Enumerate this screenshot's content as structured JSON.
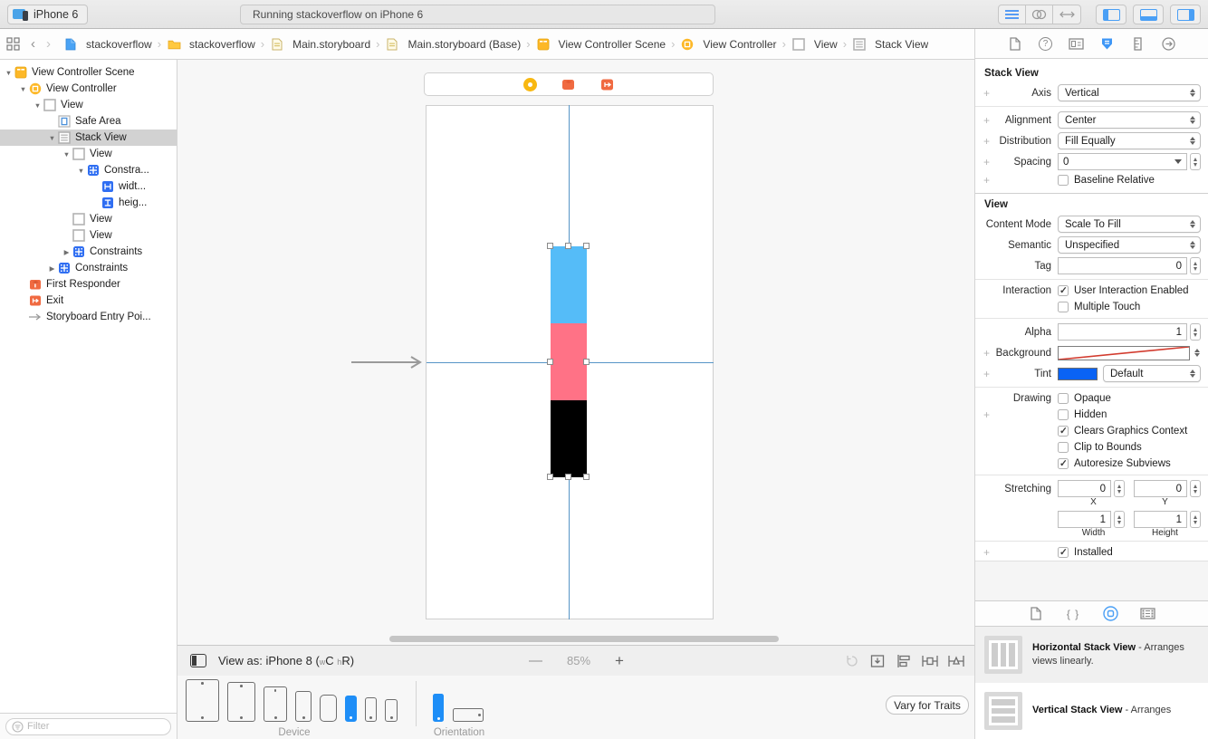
{
  "toolbar": {
    "scheme_label": "iPhone 6",
    "status_text": "Running stackoverflow on iPhone 6"
  },
  "icons": {
    "back_chevron": "‹",
    "forward_chevron": "›",
    "breadcrumb_separator": "›"
  },
  "jumpbar": {
    "items": [
      {
        "label": "stackoverflow",
        "icon": "file-blue"
      },
      {
        "label": "stackoverflow",
        "icon": "folder"
      },
      {
        "label": "Main.storyboard",
        "icon": "storyboard"
      },
      {
        "label": "Main.storyboard (Base)",
        "icon": "storyboard"
      },
      {
        "label": "View Controller Scene",
        "icon": "scene"
      },
      {
        "label": "View Controller",
        "icon": "view-controller"
      },
      {
        "label": "View",
        "icon": "view"
      },
      {
        "label": "Stack View",
        "icon": "stack-view"
      }
    ]
  },
  "outline": {
    "items": [
      {
        "label": "View Controller Scene",
        "indent": 0,
        "disc": "open",
        "icon": "scene",
        "selected": false
      },
      {
        "label": "View Controller",
        "indent": 1,
        "disc": "open",
        "icon": "view-controller",
        "selected": false
      },
      {
        "label": "View",
        "indent": 2,
        "disc": "open",
        "icon": "view",
        "selected": false
      },
      {
        "label": "Safe Area",
        "indent": 3,
        "disc": "none",
        "icon": "safe-area",
        "selected": false
      },
      {
        "label": "Stack View",
        "indent": 3,
        "disc": "open",
        "icon": "stack-view",
        "selected": true
      },
      {
        "label": "View",
        "indent": 4,
        "disc": "open",
        "icon": "view",
        "selected": false
      },
      {
        "label": "Constra...",
        "indent": 5,
        "disc": "open",
        "icon": "constraints",
        "selected": false
      },
      {
        "label": "widt...",
        "indent": 6,
        "disc": "none",
        "icon": "constraint-width",
        "selected": false
      },
      {
        "label": "heig...",
        "indent": 6,
        "disc": "none",
        "icon": "constraint-height",
        "selected": false
      },
      {
        "label": "View",
        "indent": 4,
        "disc": "none",
        "icon": "view",
        "selected": false
      },
      {
        "label": "View",
        "indent": 4,
        "disc": "none",
        "icon": "view",
        "selected": false
      },
      {
        "label": "Constraints",
        "indent": 4,
        "disc": "closed",
        "icon": "constraints",
        "selected": false
      },
      {
        "label": "Constraints",
        "indent": 3,
        "disc": "closed",
        "icon": "constraints",
        "selected": false
      },
      {
        "label": "First Responder",
        "indent": 1,
        "disc": "none",
        "icon": "first-responder",
        "selected": false
      },
      {
        "label": "Exit",
        "indent": 1,
        "disc": "none",
        "icon": "exit",
        "selected": false
      },
      {
        "label": "Storyboard Entry Poi...",
        "indent": 1,
        "disc": "none",
        "icon": "entry-point",
        "selected": false
      }
    ]
  },
  "filter": {
    "placeholder": "Filter"
  },
  "canvas": {
    "stack_colors": {
      "top": "#55BCF8",
      "middle": "#FF7286",
      "bottom": "#000000"
    },
    "view_as_prefix": "View as: iPhone 8 (",
    "trait_w_lower": "w",
    "trait_w_upper": "C",
    "trait_h_lower": "h",
    "trait_h_upper": "R",
    "view_as_suffix": ")",
    "zoom_minus": "—",
    "zoom_value": "85%",
    "zoom_plus": "+",
    "device_label": "Device",
    "orientation_label": "Orientation",
    "vary_button": "Vary for Traits"
  },
  "inspector": {
    "stack_section_title": "Stack View",
    "axis_label": "Axis",
    "axis_value": "Vertical",
    "alignment_label": "Alignment",
    "alignment_value": "Center",
    "distribution_label": "Distribution",
    "distribution_value": "Fill Equally",
    "spacing_label": "Spacing",
    "spacing_value": "0",
    "baseline_label": "Baseline Relative",
    "view_section_title": "View",
    "content_mode_label": "Content Mode",
    "content_mode_value": "Scale To Fill",
    "semantic_label": "Semantic",
    "semantic_value": "Unspecified",
    "tag_label": "Tag",
    "tag_value": "0",
    "interaction_label": "Interaction",
    "user_interaction_label": "User Interaction Enabled",
    "multiple_touch_label": "Multiple Touch",
    "alpha_label": "Alpha",
    "alpha_value": "1",
    "background_label": "Background",
    "tint_label": "Tint",
    "tint_value": "Default",
    "tint_color": "#0a63f4",
    "drawing_label": "Drawing",
    "opaque_label": "Opaque",
    "hidden_label": "Hidden",
    "clears_label": "Clears Graphics Context",
    "clip_label": "Clip to Bounds",
    "autoresize_label": "Autoresize Subviews",
    "stretching_label": "Stretching",
    "stretch_x_value": "0",
    "stretch_y_value": "0",
    "stretch_x_label": "X",
    "stretch_y_label": "Y",
    "stretch_width_value": "1",
    "stretch_height_value": "1",
    "stretch_width_label": "Width",
    "stretch_height_label": "Height",
    "installed_label": "Installed"
  },
  "library": {
    "items": [
      {
        "name": "Horizontal Stack View",
        "sep": " - ",
        "desc": "Arranges views linearly.",
        "icon": "h"
      },
      {
        "name": "Vertical Stack View",
        "sep": " - ",
        "desc": "Arranges",
        "icon": "v"
      }
    ]
  }
}
